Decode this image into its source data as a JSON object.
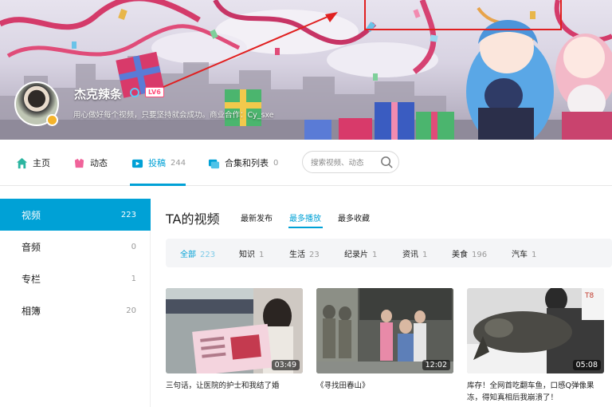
{
  "profile": {
    "username": "杰克辣条",
    "level": "LV6",
    "signature": "用心做好每个视频，只要坚持就会成功。商业合作：Cy_sxe"
  },
  "nav": {
    "items": [
      {
        "label": "主页",
        "icon": "home-icon",
        "count": ""
      },
      {
        "label": "动态",
        "icon": "dynamic-icon",
        "count": ""
      },
      {
        "label": "投稿",
        "icon": "upload-icon",
        "count": "244"
      },
      {
        "label": "合集和列表",
        "icon": "collection-icon",
        "count": "0"
      }
    ],
    "active_index": 2,
    "search_placeholder": "搜索视频、动态"
  },
  "sidebar": {
    "items": [
      {
        "label": "视频",
        "count": "223"
      },
      {
        "label": "音频",
        "count": "0"
      },
      {
        "label": "专栏",
        "count": "1"
      },
      {
        "label": "相簿",
        "count": "20"
      }
    ],
    "active_index": 0
  },
  "main": {
    "title": "TA的视频",
    "sort_tabs": [
      "最新发布",
      "最多播放",
      "最多收藏"
    ],
    "sort_active": 1,
    "filters": [
      {
        "label": "全部",
        "count": "223"
      },
      {
        "label": "知识",
        "count": "1"
      },
      {
        "label": "生活",
        "count": "23"
      },
      {
        "label": "纪录片",
        "count": "1"
      },
      {
        "label": "资讯",
        "count": "1"
      },
      {
        "label": "美食",
        "count": "196"
      },
      {
        "label": "汽车",
        "count": "1"
      }
    ],
    "filter_active": 0,
    "videos": [
      {
        "title": "三句话，让医院的护士和我结了婚",
        "duration": "03:49"
      },
      {
        "title": "《寻找田春山》",
        "duration": "12:02"
      },
      {
        "title": "库存！全网首吃翻车鱼，口感Q弹像果冻，得知真相后我崩溃了！",
        "duration": "05:08"
      }
    ]
  },
  "colors": {
    "accent": "#00a1d6",
    "annotation": "#e02020",
    "level_badge": "#ff4d7a"
  }
}
